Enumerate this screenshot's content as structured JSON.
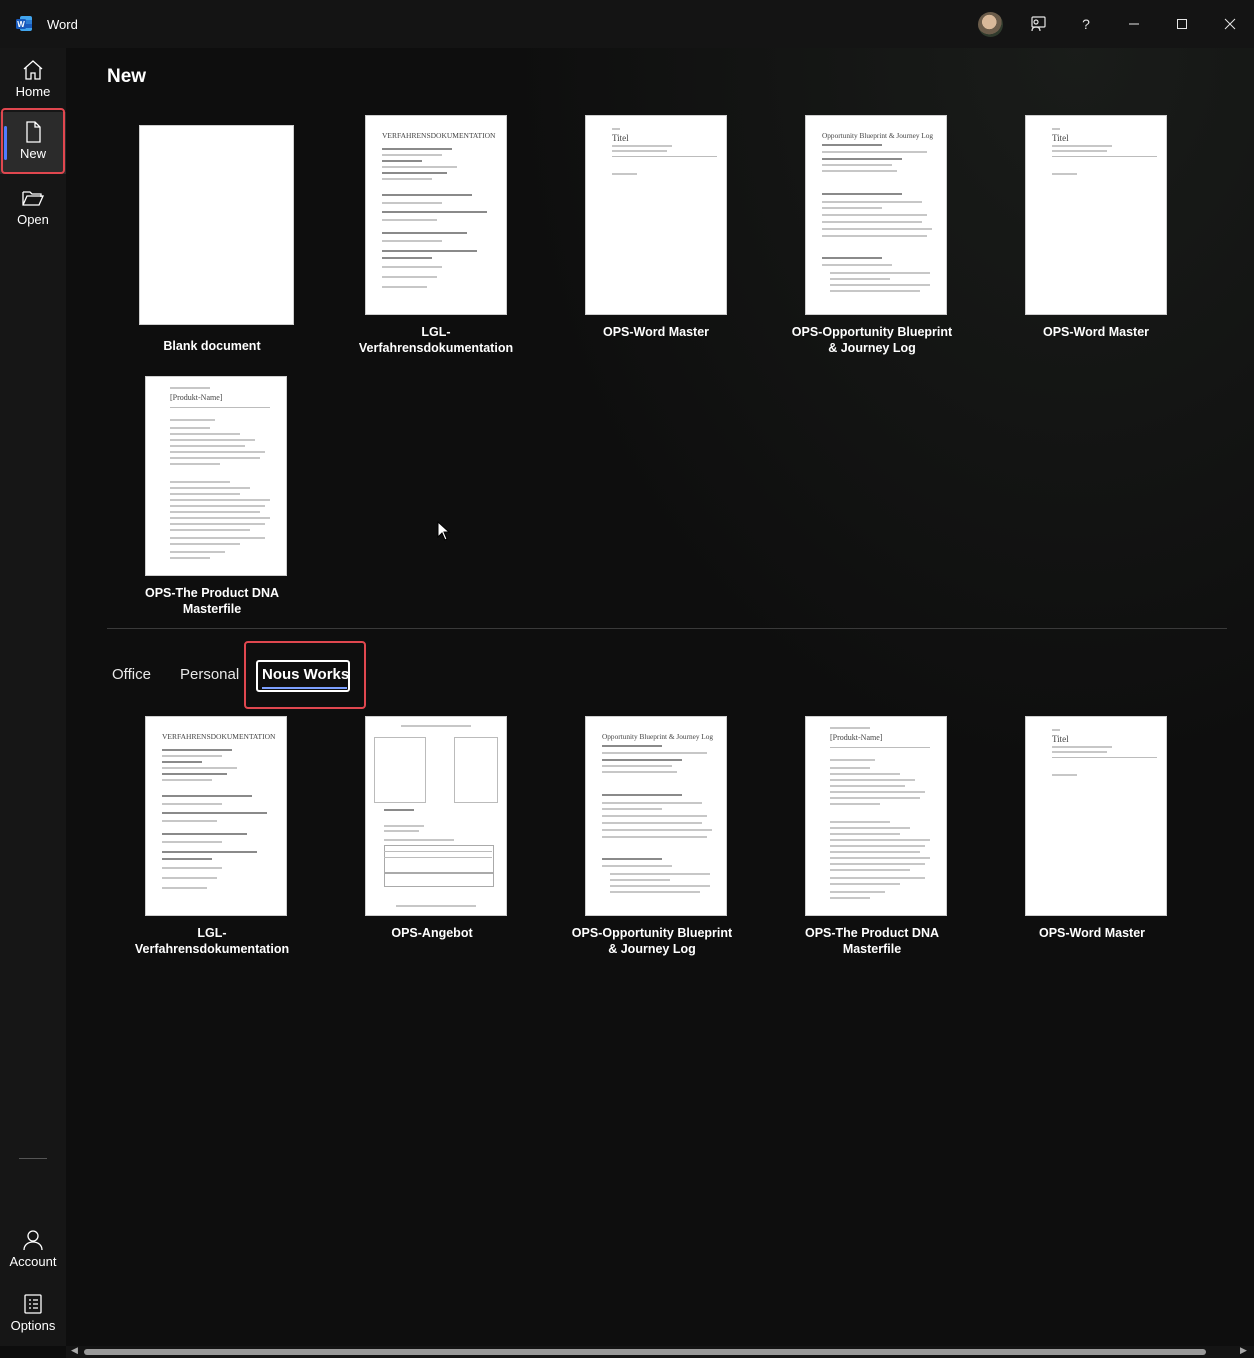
{
  "window": {
    "app_title": "Word"
  },
  "sidebar": {
    "items": [
      {
        "label": "Home"
      },
      {
        "label": "New"
      },
      {
        "label": "Open"
      }
    ],
    "bottom": [
      {
        "label": "Account"
      },
      {
        "label": "Options"
      }
    ]
  },
  "main": {
    "title": "New",
    "featured_templates": [
      {
        "label": "Blank document"
      },
      {
        "label": "LGL-\nVerfahrensdokumentation"
      },
      {
        "label": "OPS-Word Master"
      },
      {
        "label": "OPS-Opportunity Blueprint\n& Journey Log"
      },
      {
        "label": "OPS-Word Master"
      },
      {
        "label": "OPS-The Product DNA\nMasterfile"
      }
    ],
    "tabs": [
      {
        "label": "Office"
      },
      {
        "label": "Personal"
      },
      {
        "label": "Nous Works",
        "selected": true
      }
    ],
    "tab_templates": [
      {
        "label": "LGL-\nVerfahrensdokumentation"
      },
      {
        "label": "OPS-Angebot"
      },
      {
        "label": "OPS-Opportunity Blueprint\n& Journey Log"
      },
      {
        "label": "OPS-The Product DNA\nMasterfile"
      },
      {
        "label": "OPS-Word Master"
      }
    ]
  },
  "thumb_text": {
    "verfahren": "VERFAHRENSDOKUMENTATION",
    "titel": "Titel",
    "blueprint": "Opportunity Blueprint & Journey Log",
    "produkt": "[Produkt-Name]"
  },
  "colors": {
    "accent": "#4f7cff",
    "highlight": "#e0474f",
    "background": "#0e0e0e"
  }
}
